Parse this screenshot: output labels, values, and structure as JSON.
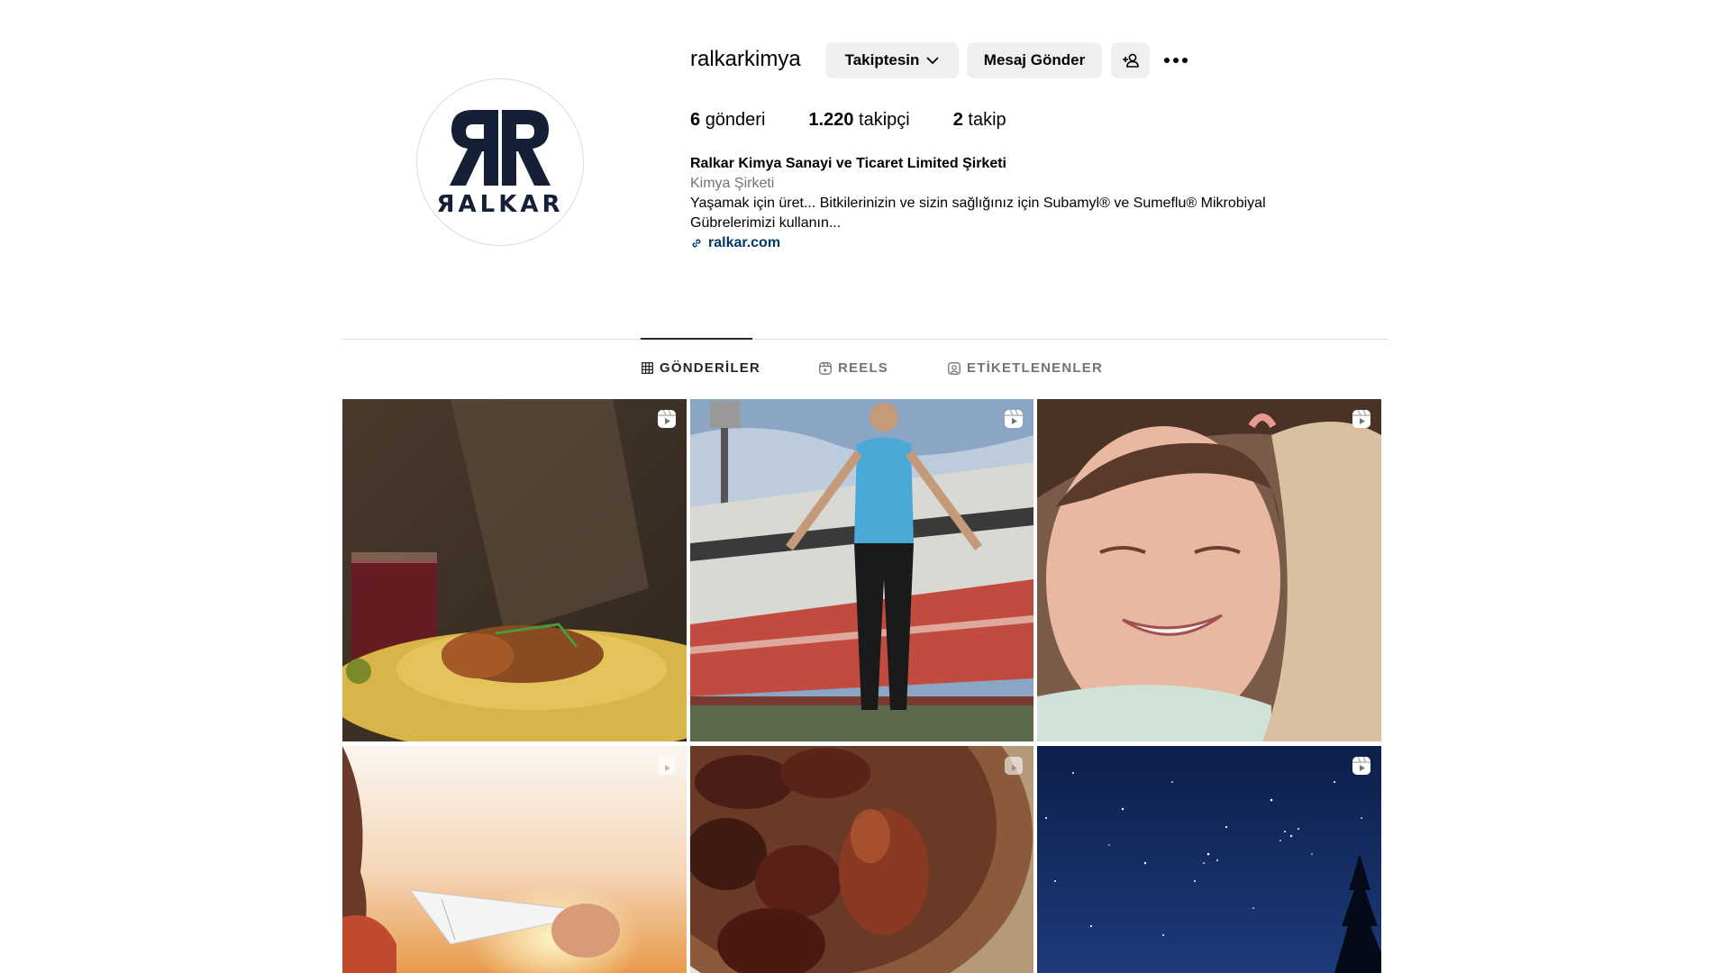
{
  "profile": {
    "username": "ralkarkimya",
    "avatar_text": "ЯALKAR",
    "follow_button": "Takiptesin",
    "message_button": "Mesaj Gönder",
    "stats": [
      {
        "value": "6",
        "label": "gönderi"
      },
      {
        "value": "1.220",
        "label": "takipçi"
      },
      {
        "value": "2",
        "label": "takip"
      }
    ],
    "full_name": "Ralkar Kimya Sanayi ve Ticaret Limited Şirketi",
    "category": "Kimya Şirketi",
    "bio_line1": "Yaşamak için üret... Bitkilerinizin ve sizin sağlığınız için Subamyl® ve Sumeflu® Mikrobiyal",
    "bio_line2": "Gübrelerimizi kullanın...",
    "website": "ralkar.com"
  },
  "tabs": [
    {
      "label": "GÖNDERİLER",
      "icon": "grid-icon",
      "active": true
    },
    {
      "label": "REELS",
      "icon": "reels-icon",
      "active": false
    },
    {
      "label": "ETİKETLENENLER",
      "icon": "tagged-icon",
      "active": false
    }
  ],
  "posts": [
    {
      "scene": "food-plate-with-drink",
      "reel": true
    },
    {
      "scene": "athlete-jumping-rope-in-stadium",
      "reel": true
    },
    {
      "scene": "smiling-girl",
      "reel": true
    },
    {
      "scene": "paper-plane-at-sunset",
      "reel": true
    },
    {
      "scene": "dates-in-bowl",
      "reel": true
    },
    {
      "scene": "starry-night-sky",
      "reel": true
    }
  ],
  "colors": {
    "brand_navy": "#152036",
    "button_bg": "#efefef",
    "link": "#00376b",
    "muted_text": "#737373"
  }
}
